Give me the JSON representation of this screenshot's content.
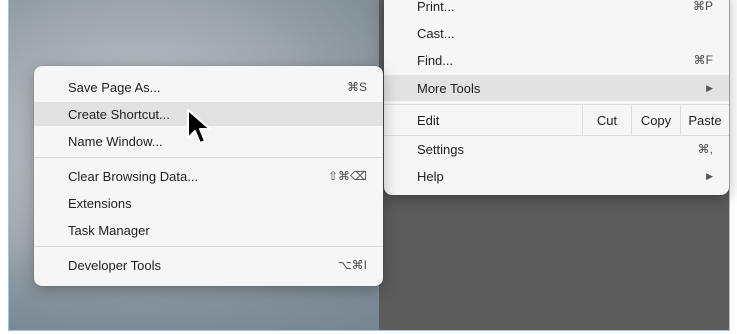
{
  "main_menu": {
    "print": {
      "label": "Print...",
      "shortcut": "⌘P"
    },
    "cast": {
      "label": "Cast..."
    },
    "find": {
      "label": "Find...",
      "shortcut": "⌘F"
    },
    "more_tools": {
      "label": "More Tools"
    },
    "edit": {
      "label": "Edit",
      "cut": "Cut",
      "copy": "Copy",
      "paste": "Paste"
    },
    "settings": {
      "label": "Settings",
      "shortcut": "⌘,"
    },
    "help": {
      "label": "Help"
    }
  },
  "submenu": {
    "save_page_as": {
      "label": "Save Page As...",
      "shortcut": "⌘S"
    },
    "create_shortcut": {
      "label": "Create Shortcut..."
    },
    "name_window": {
      "label": "Name Window..."
    },
    "clear_browsing_data": {
      "label": "Clear Browsing Data...",
      "shortcut": "⇧⌘⌫"
    },
    "extensions": {
      "label": "Extensions"
    },
    "task_manager": {
      "label": "Task Manager"
    },
    "developer_tools": {
      "label": "Developer Tools",
      "shortcut": "⌥⌘I"
    }
  },
  "colors": {
    "highlight": "#e2e2e2",
    "menu_bg": "#f6f6f6",
    "dark_bg": "#5c5c5c"
  },
  "icons": {
    "submenu_arrow": "chevron-right-icon",
    "pointer": "mouse-cursor-icon"
  }
}
